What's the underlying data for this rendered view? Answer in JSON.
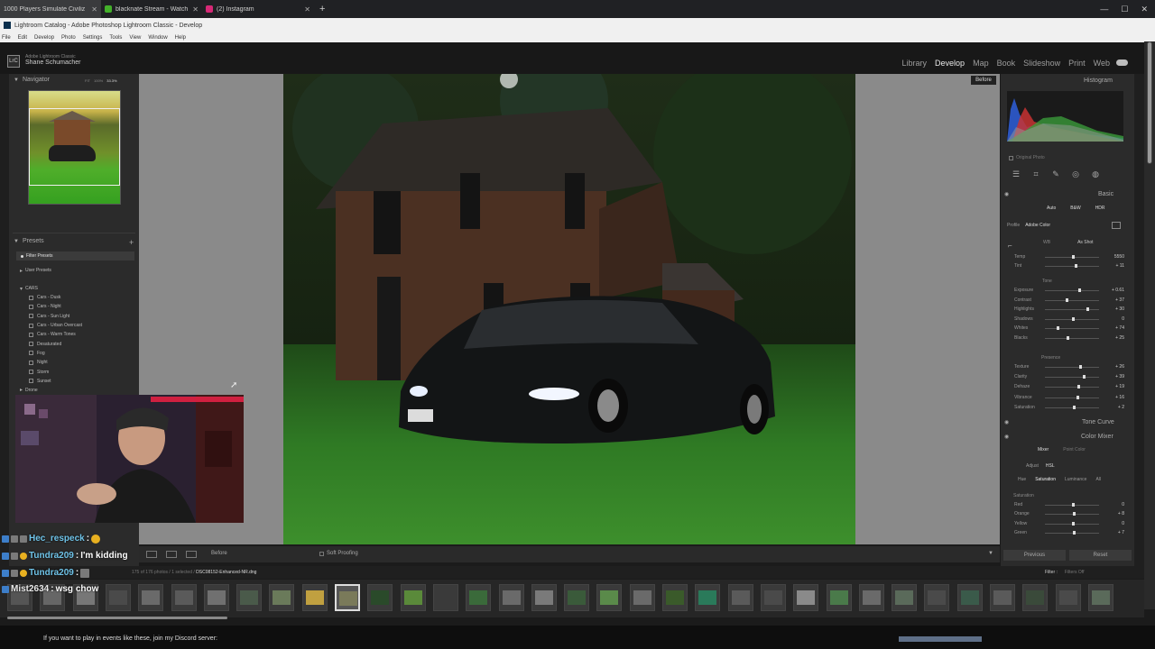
{
  "browser": {
    "tabs": [
      {
        "title": "1000 Players Simulate Civiliz",
        "color": "#d33"
      },
      {
        "title": "blacknate Stream - Watch Live",
        "color": "#43b02a"
      },
      {
        "title": "(2) Instagram",
        "color": "#d62976"
      }
    ],
    "new_tab": "+"
  },
  "window": {
    "title": "Lightroom Catalog - Adobe Photoshop Lightroom Classic - Develop",
    "menu": [
      "File",
      "Edit",
      "Develop",
      "Photo",
      "Settings",
      "Tools",
      "View",
      "Window",
      "Help"
    ]
  },
  "identity": {
    "logo": "LrC",
    "app": "Adobe Lightroom Classic",
    "user": "Shane Schumacher"
  },
  "modules": [
    {
      "label": "Library"
    },
    {
      "label": "Develop"
    },
    {
      "label": "Map"
    },
    {
      "label": "Book"
    },
    {
      "label": "Slideshow"
    },
    {
      "label": "Print"
    },
    {
      "label": "Web"
    }
  ],
  "left": {
    "navigator_title": "Navigator",
    "nav_opts": [
      "FIT",
      "100%",
      "33.3%"
    ],
    "presets_title": "Presets",
    "filter_presets": "Filter Presets",
    "user_presets": "User Presets",
    "group": "CARS",
    "items": [
      "Cars - Dusk",
      "Cars - Night",
      "Cars - Sun Light",
      "Cars - Urban Overcast",
      "Cars - Warm Tones",
      "Desaturated",
      "Fog",
      "Night",
      "Storm",
      "Sunset"
    ],
    "drone": "Drone"
  },
  "workspace": {
    "before_label": "Before"
  },
  "right": {
    "histogram_title": "Histogram",
    "original_photo": "Original Photo",
    "basic_title": "Basic",
    "auto": "Auto",
    "bw": "B&W",
    "hdr": "HDR",
    "profile_label": "Profile",
    "profile_value": "Adobe Color",
    "wb_label": "WB",
    "wb_value": "As Shot",
    "wb_sliders": [
      {
        "label": "Temp",
        "value": "5550",
        "pos": 0.5
      },
      {
        "label": "Tint",
        "value": "+ 11",
        "pos": 0.55
      }
    ],
    "tone_label": "Tone",
    "tone_sliders": [
      {
        "label": "Exposure",
        "value": "+ 0.61",
        "pos": 0.62
      },
      {
        "label": "Contrast",
        "value": "+ 37",
        "pos": 0.38
      },
      {
        "label": "Highlights",
        "value": "+ 30",
        "pos": 0.76
      },
      {
        "label": "Shadows",
        "value": "0",
        "pos": 0.5
      },
      {
        "label": "Whites",
        "value": "+ 74",
        "pos": 0.22
      },
      {
        "label": "Blacks",
        "value": "+ 25",
        "pos": 0.4
      }
    ],
    "presence_label": "Presence",
    "presence_sliders": [
      {
        "label": "Texture",
        "value": "+ 26",
        "pos": 0.64
      },
      {
        "label": "Clarity",
        "value": "+ 39",
        "pos": 0.7
      },
      {
        "label": "Dehaze",
        "value": "+ 19",
        "pos": 0.6
      },
      {
        "label": "Vibrance",
        "value": "+ 16",
        "pos": 0.58
      },
      {
        "label": "Saturation",
        "value": "+ 2",
        "pos": 0.51
      }
    ],
    "tone_curve": "Tone Curve",
    "color_mixer": "Color Mixer",
    "mixer": "Mixer",
    "point_color": "Point Color",
    "adjust_label": "Adjust",
    "adjust_value": "HSL",
    "hsl_tabs": [
      "Hue",
      "Saturation",
      "Luminance",
      "All"
    ],
    "saturation_label": "Saturation",
    "hsl_sliders": [
      {
        "label": "Red",
        "value": "0",
        "pos": 0.5
      },
      {
        "label": "Orange",
        "value": "+ 8",
        "pos": 0.52
      },
      {
        "label": "Yellow",
        "value": "0",
        "pos": 0.5
      },
      {
        "label": "Green",
        "value": "+ 7",
        "pos": 0.52
      }
    ],
    "previous": "Previous",
    "reset": "Reset"
  },
  "toolbar": {
    "before": "Before",
    "soft_proofing": "Soft Proofing"
  },
  "filmstrip": {
    "count": "175 of 176 photos / 1 selected /",
    "file": "DSC08152-Enhanced-NR.dng",
    "filter_label": "Filter :",
    "filter_value": "Filters Off",
    "thumb_colors": [
      "#555",
      "#666",
      "#777",
      "#4a4a4a",
      "#6a6a6a",
      "#5a5a5a",
      "#707070",
      "#4a5a4a",
      "#6a7a5a",
      "#c0a040",
      "#7a7a5a",
      "#2a4a2a",
      "#5a8a3a",
      "#3a3a3a",
      "#3a6a3a",
      "#6a6a6a",
      "#7a7a7a",
      "#3a5a3a",
      "#5a8a4a",
      "#6a6a6a",
      "#3a5a2a",
      "#2a7a5a",
      "#5a5a5a",
      "#4a4a4a",
      "#8a8a8a",
      "#4a7a4a",
      "#6a6a6a",
      "#5a6a5a",
      "#4a4a4a",
      "#3a5a4a",
      "#5a5a5a",
      "#3a4a3a",
      "#4a4a4a",
      "#5a6a5a"
    ]
  },
  "chat": [
    {
      "user": "Hec_respeck",
      "text": ""
    },
    {
      "user": "Tundra209",
      "text": "I'm kidding"
    },
    {
      "user": "Tundra209",
      "text": ""
    },
    {
      "user": "Mist2634",
      "text": "wsg chow"
    }
  ],
  "banner": "If you want to play in events like these, join my Discord server:"
}
